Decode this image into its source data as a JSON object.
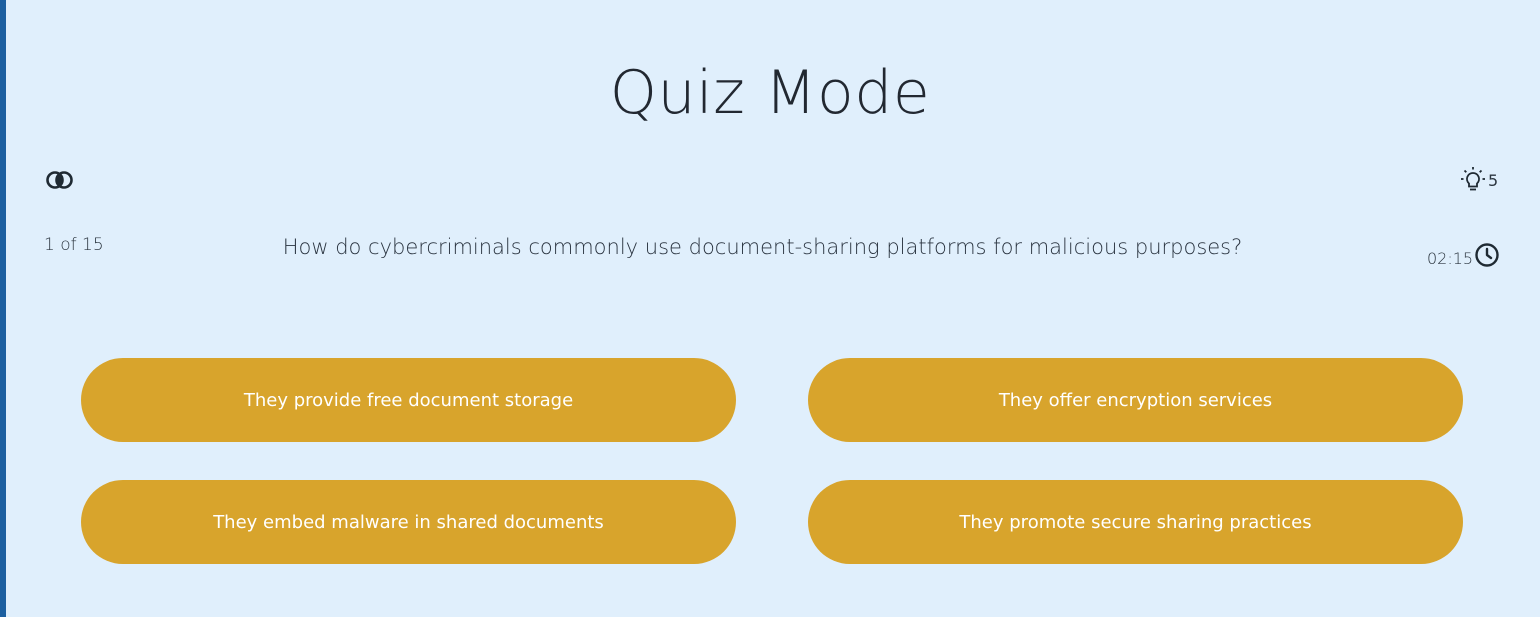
{
  "title": "Quiz Mode",
  "hints": {
    "icon": "lightbulb-icon",
    "count": "5"
  },
  "toggle": {
    "icon": "overlap-circles-icon"
  },
  "progress": {
    "label": "1 of 15"
  },
  "question": {
    "text": "How do cybercriminals commonly use document-sharing platforms for malicious purposes?"
  },
  "timer": {
    "text": "02:15",
    "icon": "clock-icon"
  },
  "answers": [
    {
      "label": "They provide free document storage"
    },
    {
      "label": "They offer encryption services"
    },
    {
      "label": "They embed malware in shared documents"
    },
    {
      "label": "They promote secure sharing practices"
    }
  ],
  "colors": {
    "background": "#e0effc",
    "answer_button": "#d8a42c",
    "accent_bar": "#1c5fa0"
  }
}
